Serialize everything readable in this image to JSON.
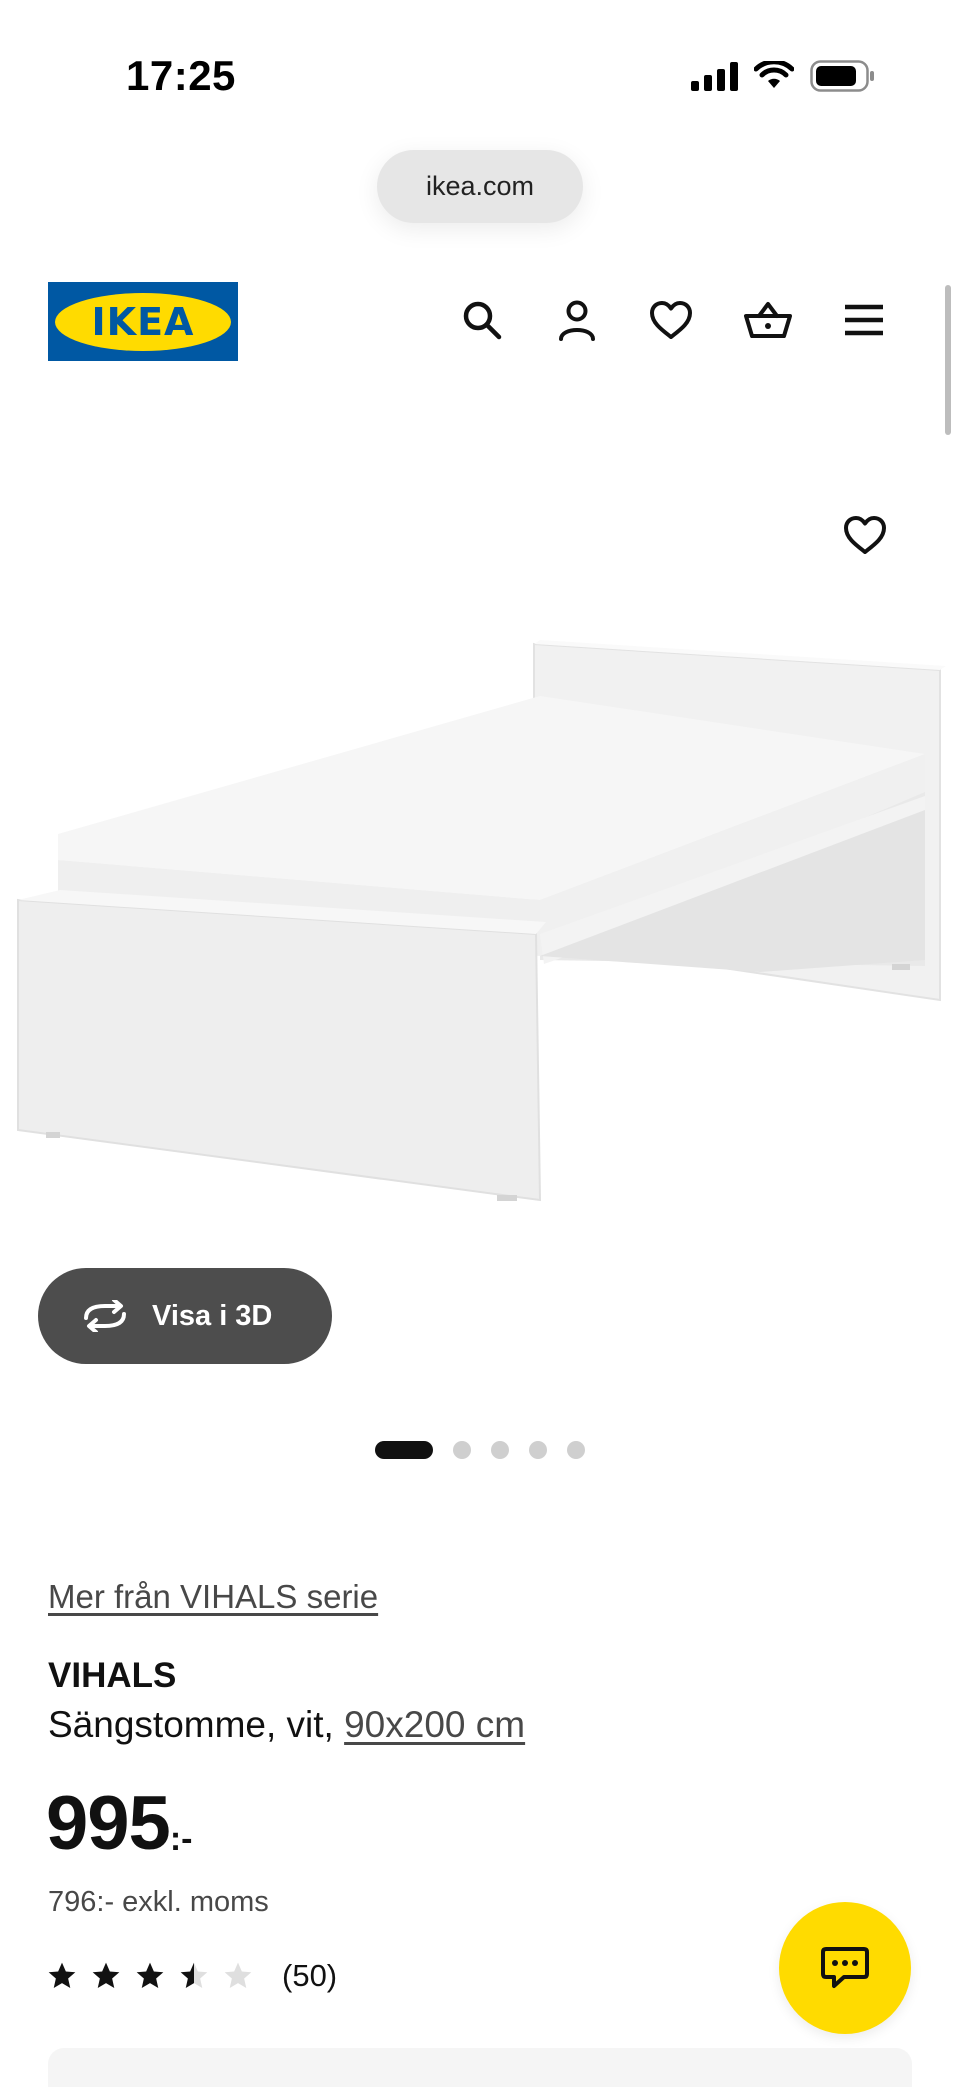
{
  "status_bar": {
    "time": "17:25",
    "icons": [
      "cellular-signal-icon",
      "wifi-icon",
      "battery-icon"
    ]
  },
  "browser": {
    "url": "ikea.com"
  },
  "header": {
    "logo_text": "IKEA",
    "icons": [
      "search-icon",
      "account-icon",
      "wishlist-icon",
      "cart-icon",
      "menu-icon"
    ]
  },
  "gallery": {
    "view_3d_label": "Visa i 3D",
    "image_count": 5,
    "active_index": 0
  },
  "product": {
    "series_link": "Mer från VIHALS serie",
    "name": "VIHALS",
    "description": "Sängstomme, vit, ",
    "size": "90x200 cm",
    "price_integer": "995",
    "price_suffix": ":-",
    "price_excl_vat": "796:- exkl. moms",
    "rating": 3.5,
    "rating_max": 5,
    "review_count": "(50)"
  },
  "colors": {
    "ikea_blue": "#0058a3",
    "ikea_yellow": "#ffdb00",
    "button_dark": "#4d4d4d"
  }
}
